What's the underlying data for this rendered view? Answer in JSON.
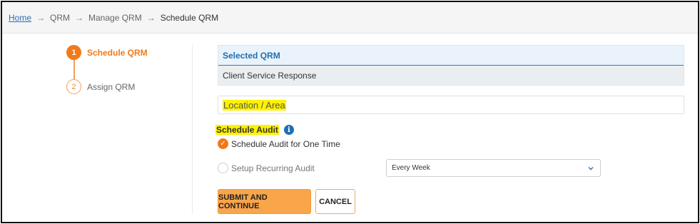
{
  "breadcrumb": {
    "items": [
      "Home",
      "QRM",
      "Manage QRM",
      "Schedule QRM"
    ],
    "separator": "→"
  },
  "stepper": {
    "steps": [
      {
        "number": "1",
        "label": "Schedule QRM",
        "state": "active"
      },
      {
        "number": "2",
        "label": "Assign QRM",
        "state": "pending"
      }
    ]
  },
  "selected_qrm": {
    "header": "Selected QRM",
    "value": "Client Service Response"
  },
  "location": {
    "placeholder": "Location / Area"
  },
  "schedule_audit": {
    "label": "Schedule Audit",
    "info_icon": "i",
    "options": [
      {
        "label": "Schedule Audit for One Time",
        "checked": true
      },
      {
        "label": "Setup Recurring Audit",
        "checked": false
      }
    ],
    "frequency_selected": "Every Week"
  },
  "buttons": {
    "submit": "SUBMIT AND CONTINUE",
    "cancel": "CANCEL"
  },
  "colors": {
    "accent": "#f07a1a",
    "link": "#2a6fb0",
    "highlight": "#fff200",
    "button_primary": "#f9a54a"
  }
}
